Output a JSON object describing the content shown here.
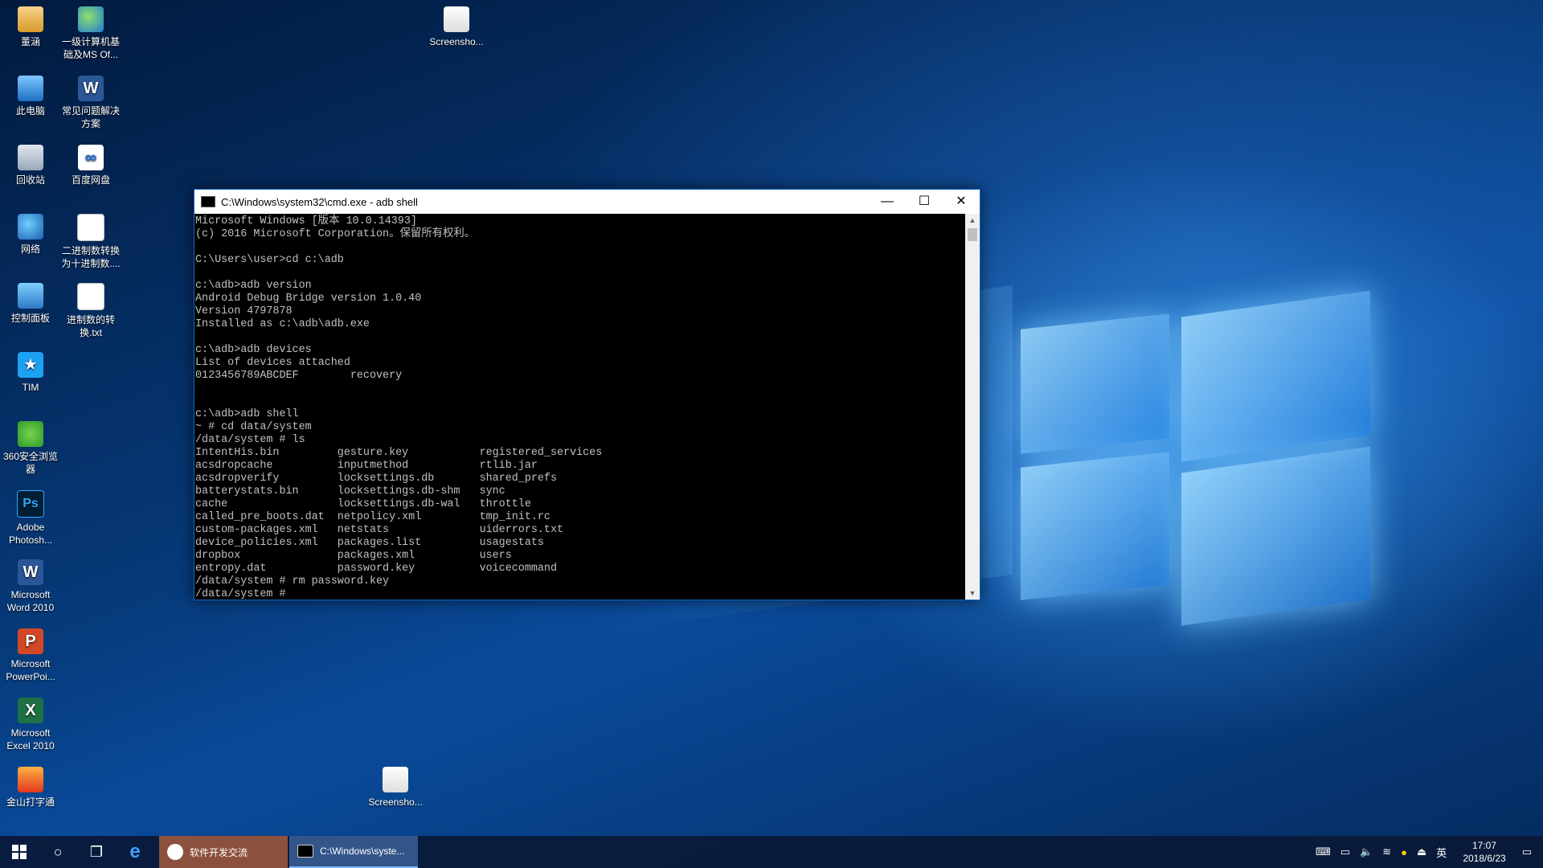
{
  "desktop": {
    "icons": [
      {
        "label": "董涵"
      },
      {
        "label": "一级计算机基础及MS Of..."
      },
      {
        "label": "此电脑"
      },
      {
        "label": "常见问题解决方案"
      },
      {
        "label": "回收站"
      },
      {
        "label": "百度网盘"
      },
      {
        "label": "网络"
      },
      {
        "label": "二进制数转换为十进制数...."
      },
      {
        "label": "控制面板"
      },
      {
        "label": "进制数的转换.txt"
      },
      {
        "label": "TIM"
      },
      {
        "label": "360安全浏览器"
      },
      {
        "label": "Adobe Photosh..."
      },
      {
        "label": "Microsoft Word 2010"
      },
      {
        "label": "Microsoft PowerPoi..."
      },
      {
        "label": "Microsoft Excel 2010"
      },
      {
        "label": "金山打字通"
      },
      {
        "label": "Screensho..."
      },
      {
        "label": "Screensho..."
      }
    ]
  },
  "cmd_window": {
    "title": "C:\\Windows\\system32\\cmd.exe - adb  shell",
    "minimize": "—",
    "maximize": "☐",
    "close": "✕",
    "console_text": "Microsoft Windows [版本 10.0.14393]\n(c) 2016 Microsoft Corporation。保留所有权利。\n\nC:\\Users\\user>cd c:\\adb\n\nc:\\adb>adb version\nAndroid Debug Bridge version 1.0.40\nVersion 4797878\nInstalled as c:\\adb\\adb.exe\n\nc:\\adb>adb devices\nList of devices attached\n0123456789ABCDEF        recovery\n\n\nc:\\adb>adb shell\n~ # cd data/system\n/data/system # ls\nIntentHis.bin         gesture.key           registered_services\nacsdropcache          inputmethod           rtlib.jar\nacsdropverify         locksettings.db       shared_prefs\nbatterystats.bin      locksettings.db-shm   sync\ncache                 locksettings.db-wal   throttle\ncalled_pre_boots.dat  netpolicy.xml         tmp_init.rc\ncustom-packages.xml   netstats              uiderrors.txt\ndevice_policies.xml   packages.list         usagestats\ndropbox               packages.xml          users\nentropy.dat           password.key          voicecommand\n/data/system # rm password.key\n/data/system # "
  },
  "taskbar": {
    "start_icon": "windows-start",
    "search_icon": "○",
    "taskview_icon": "❐",
    "edge_icon": "e",
    "app1_label": "软件开发交流",
    "app2_label": "C:\\Windows\\syste...",
    "ime_label": "英",
    "time": "17:07",
    "date": "2018/6/23",
    "notify_icon": "▭"
  }
}
